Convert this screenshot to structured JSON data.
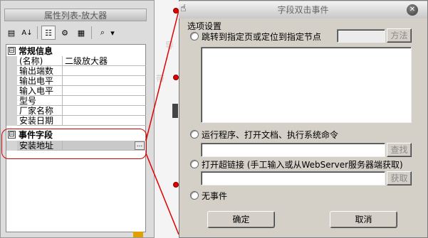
{
  "property_panel": {
    "title": "属性列表-放大器",
    "toolbar": [
      {
        "name": "categorized-view-icon",
        "glyph": "▤"
      },
      {
        "name": "alphabetical-sort-icon",
        "glyph": "A↓"
      },
      {
        "name": "properties-icon",
        "glyph": "☷"
      },
      {
        "name": "events-icon",
        "glyph": "⚙"
      },
      {
        "name": "property-pages-icon",
        "glyph": "▦"
      },
      {
        "name": "filter-icon",
        "glyph": "⌕"
      },
      {
        "name": "dropdown-arrow-icon",
        "glyph": "▾"
      }
    ],
    "categories": {
      "general": {
        "label": "常规信息",
        "toggle": "⊟"
      },
      "event": {
        "label": "事件字段",
        "toggle": "⊟"
      }
    },
    "rows": [
      {
        "name": "(名称)",
        "value": "二级放大器"
      },
      {
        "name": "输出端数",
        "value": ""
      },
      {
        "name": "输出电平",
        "value": ""
      },
      {
        "name": "输入电平",
        "value": ""
      },
      {
        "name": "型号",
        "value": ""
      },
      {
        "name": "厂家名称",
        "value": ""
      },
      {
        "name": "安装日期",
        "value": ""
      }
    ],
    "event_rows": [
      {
        "name": "安装地址",
        "value": "",
        "button": "..."
      }
    ]
  },
  "canvas": {
    "faint_text_1": "导",
    "faint_text_2": "带"
  },
  "dialog": {
    "title": "字段双击事件",
    "close_glyph": "✕",
    "group_label": "选项设置",
    "option_jump": {
      "label": "跳转到指定页或定位到指定节点",
      "input_value": "",
      "button": "方法"
    },
    "option_run": {
      "label": "运行程序、打开文档、执行系统命令",
      "input_value": "",
      "button": "查找"
    },
    "option_link": {
      "label": "打开超链接  (手工输入或从WebServer服务器端获取)",
      "input_value": "",
      "button": "获取"
    },
    "option_none": {
      "label": "无事件"
    },
    "ok_button": "确定",
    "cancel_button": "取消"
  },
  "colors": {
    "highlight_red": "#d00000",
    "dialog_bg": "#d4d0c8",
    "panel_bg": "#dcdcdc"
  }
}
